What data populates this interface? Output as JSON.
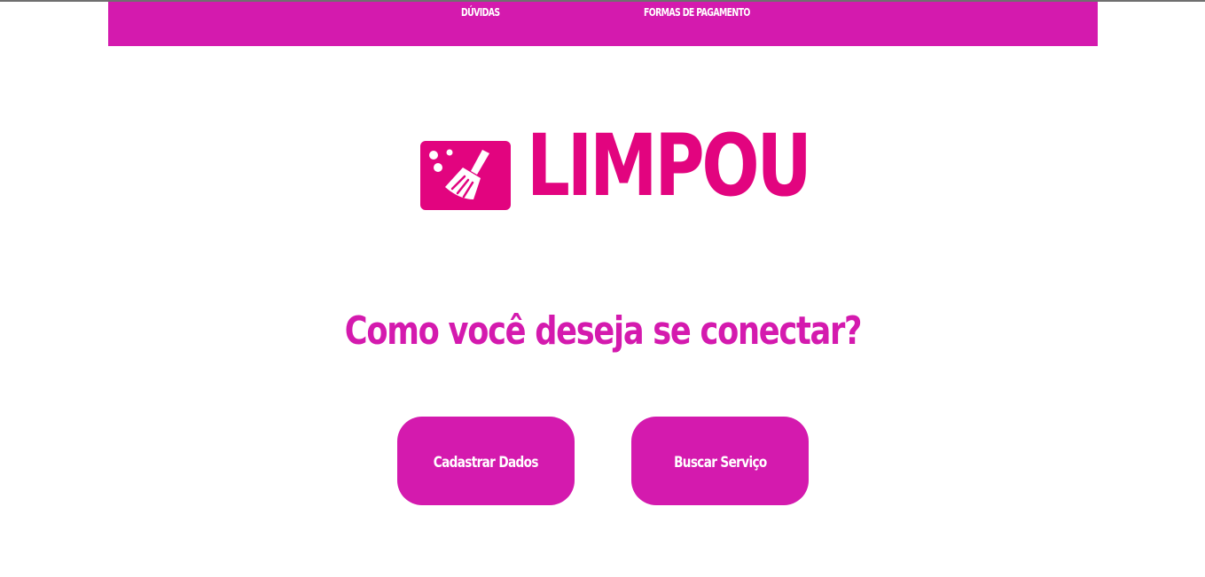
{
  "nav": {
    "items": [
      {
        "label": "DÚVIDAS"
      },
      {
        "label": "FORMAS DE PAGAMENTO"
      }
    ]
  },
  "logo": {
    "text": "LIMPOU",
    "icon": "broom-icon"
  },
  "main": {
    "question": "Como você deseja se conectar?",
    "buttons": [
      {
        "label": "Cadastrar Dados"
      },
      {
        "label": "Buscar Serviço"
      }
    ]
  },
  "colors": {
    "brand_magenta": "#d41aae",
    "logo_pink": "#e2047f",
    "background": "#ffffff"
  }
}
